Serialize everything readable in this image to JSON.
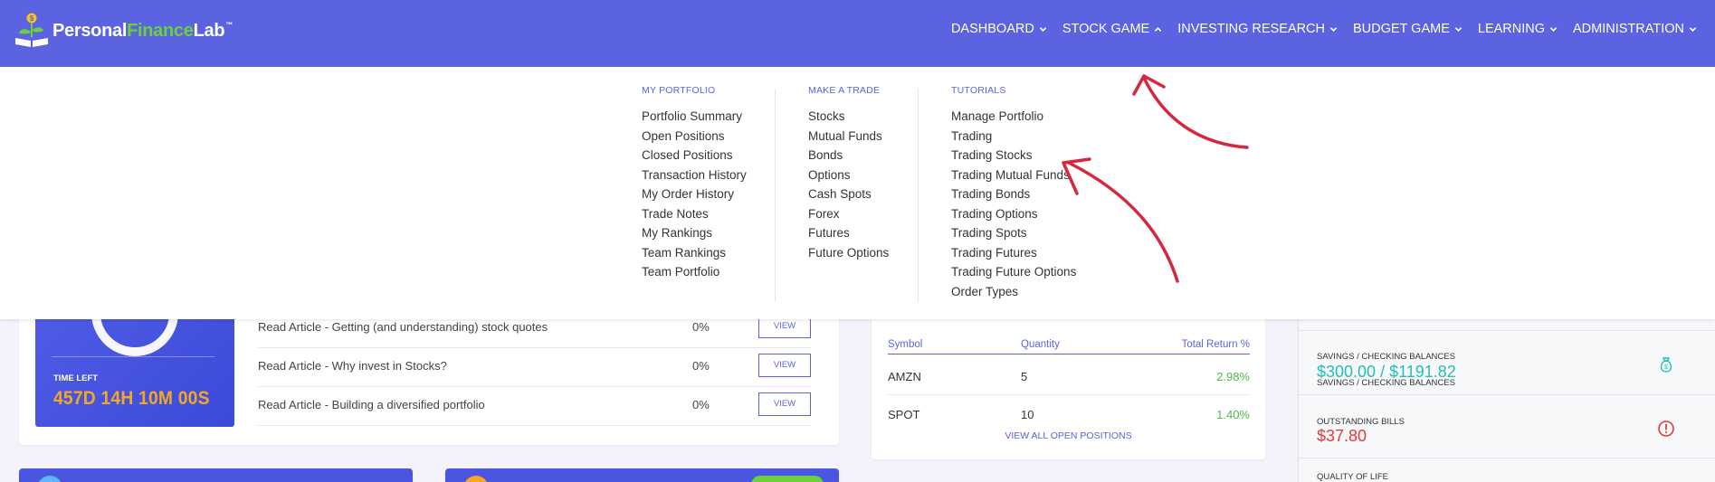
{
  "app": {
    "logo": {
      "part1": "Personal",
      "part2": "Finance",
      "part3": "Lab",
      "tm": "™"
    }
  },
  "nav": {
    "items": [
      {
        "label": "DASHBOARD",
        "chevron": "chevron-down-icon"
      },
      {
        "label": "STOCK GAME",
        "chevron": "chevron-up-icon"
      },
      {
        "label": "INVESTING RESEARCH",
        "chevron": "chevron-down-icon"
      },
      {
        "label": "BUDGET GAME",
        "chevron": "chevron-down-icon"
      },
      {
        "label": "LEARNING",
        "chevron": "chevron-down-icon"
      },
      {
        "label": "ADMINISTRATION",
        "chevron": "chevron-down-icon"
      }
    ]
  },
  "dropdown": {
    "columns": [
      {
        "heading": "MY PORTFOLIO",
        "links": [
          "Portfolio Summary",
          "Open Positions",
          "Closed Positions",
          "Transaction History",
          "My Order History",
          "Trade Notes",
          "My Rankings",
          "Team Rankings",
          "Team Portfolio"
        ]
      },
      {
        "heading": "MAKE A TRADE",
        "links": [
          "Stocks",
          "Mutual Funds",
          "Bonds",
          "Options",
          "Cash Spots",
          "Forex",
          "Futures",
          "Future Options"
        ]
      },
      {
        "heading": "TUTORIALS",
        "links": [
          "Manage Portfolio",
          "Trading",
          "Trading Stocks",
          "Trading Mutual Funds",
          "Trading Bonds",
          "Trading Options",
          "Trading Spots",
          "Trading Futures",
          "Trading Future Options",
          "Order Types"
        ]
      }
    ]
  },
  "timer": {
    "label": "TIME LEFT",
    "value": "457D 14H 10M 00S"
  },
  "tasks": [
    {
      "name": "Read Article - Getting (and understanding) stock quotes",
      "pct": "0%",
      "button": "VIEW"
    },
    {
      "name": "Read Article - Why invest in Stocks?",
      "pct": "0%",
      "button": "VIEW"
    },
    {
      "name": "Read Article - Building a diversified portfolio",
      "pct": "0%",
      "button": "VIEW"
    }
  ],
  "positions": {
    "headers": {
      "symbol": "Symbol",
      "quantity": "Quantity",
      "return": "Total Return %"
    },
    "rows": [
      {
        "symbol": "AMZN",
        "quantity": "5",
        "return": "2.98%"
      },
      {
        "symbol": "SPOT",
        "quantity": "10",
        "return": "1.40%"
      }
    ],
    "link": "VIEW ALL OPEN POSITIONS"
  },
  "finances": {
    "savings_label": "SAVINGS / CHECKING BALANCES",
    "savings_value": "$300.00 / $1191.82",
    "bills_label": "OUTSTANDING BILLS",
    "bills_value": "$37.80",
    "quality_label": "QUALITY OF LIFE"
  },
  "colors": {
    "nav_bg": "#5c63e0",
    "accent": "#5c63e0",
    "positive": "#4cbb4c",
    "teal": "#1fbfb8",
    "danger": "#e23b3b",
    "timer": "#f5a623",
    "annotation": "#d7263d"
  }
}
